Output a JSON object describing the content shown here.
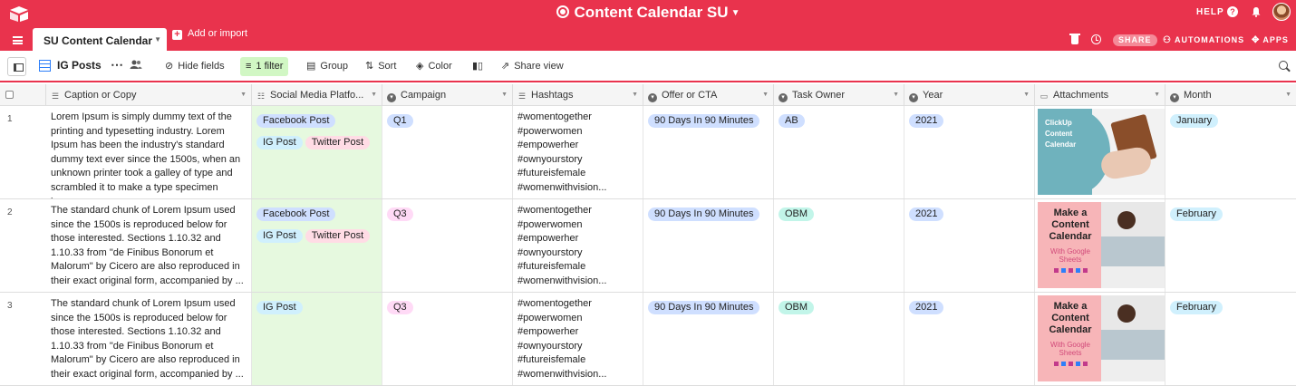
{
  "topbar": {
    "base_title": "Content Calendar SU",
    "help_label": "HELP",
    "tab_label": "SU Content Calendar",
    "add_import_label": "Add or import",
    "share_label": "SHARE",
    "automations_label": "AUTOMATIONS",
    "apps_label": "APPS",
    "colors": {
      "bar": "#e9334d"
    }
  },
  "toolbar": {
    "view_name": "IG Posts",
    "hide_fields": "Hide fields",
    "filter": "1 filter",
    "group": "Group",
    "sort": "Sort",
    "color": "Color",
    "share_view": "Share view"
  },
  "columns": [
    {
      "label": "Caption or Copy",
      "icon": "long-text-icon"
    },
    {
      "label": "Social Media Platfo...",
      "icon": "multi-select-icon"
    },
    {
      "label": "Campaign",
      "icon": "single-select-icon"
    },
    {
      "label": "Hashtags",
      "icon": "long-text-icon"
    },
    {
      "label": "Offer or CTA",
      "icon": "single-select-icon"
    },
    {
      "label": "Task Owner",
      "icon": "single-select-icon"
    },
    {
      "label": "Year",
      "icon": "single-select-icon"
    },
    {
      "label": "Attachments",
      "icon": "attachment-icon"
    },
    {
      "label": "Month",
      "icon": "single-select-icon"
    }
  ],
  "rows": [
    {
      "num": "1",
      "caption": "Lorem Ipsum is simply dummy text of the printing and typesetting industry. Lorem Ipsum has been the industry's standard dummy text ever since the 1500s, when an unknown printer took a galley of type and scrambled it to make a type specimen boo...",
      "platforms": [
        "Facebook Post",
        "IG Post",
        "Twitter Post"
      ],
      "campaign": "Q1",
      "hashtags": [
        "#womentogether",
        "#powerwomen",
        "#empowerher",
        "#ownyourstory",
        "#futureisfemale",
        "#womenwithvision..."
      ],
      "offer": "90 Days In 90 Minutes",
      "owner": "AB",
      "year": "2021",
      "attachment_text": "ClickUp Content Calendar",
      "month": "January"
    },
    {
      "num": "2",
      "caption": "The standard chunk of Lorem Ipsum used since the 1500s is reproduced below for those interested. Sections 1.10.32 and 1.10.33 from \"de Finibus Bonorum et Malorum\" by Cicero are also reproduced in their exact original form, accompanied by ...",
      "platforms": [
        "Facebook Post",
        "IG Post",
        "Twitter Post"
      ],
      "campaign": "Q3",
      "hashtags": [
        "#womentogether",
        "#powerwomen",
        "#empowerher",
        "#ownyourstory",
        "#futureisfemale",
        "#womenwithvision..."
      ],
      "offer": "90 Days In 90 Minutes",
      "owner": "OBM",
      "year": "2021",
      "attachment_text": "Make a Content Calendar",
      "attachment_sub": "With Google Sheets",
      "month": "February"
    },
    {
      "num": "3",
      "caption": "The standard chunk of Lorem Ipsum used since the 1500s is reproduced below for those interested. Sections 1.10.32 and 1.10.33 from \"de Finibus Bonorum et Malorum\" by Cicero are also reproduced in their exact original form, accompanied by ...",
      "platforms": [
        "IG Post"
      ],
      "campaign": "Q3",
      "hashtags": [
        "#womentogether",
        "#powerwomen",
        "#empowerher",
        "#ownyourstory",
        "#futureisfemale",
        "#womenwithvision..."
      ],
      "offer": "90 Days In 90 Minutes",
      "owner": "OBM",
      "year": "2021",
      "attachment_text": "Make a Content Calendar",
      "attachment_sub": "With Google Sheets",
      "month": "February"
    }
  ],
  "chip_colors": {
    "Facebook Post": "#cfdfff",
    "IG Post": "#d0f0fd",
    "Twitter Post": "#ffdce5",
    "Q1": "#cfdfff",
    "Q3": "#ffdaf6",
    "90 Days In 90 Minutes": "#cfdfff",
    "AB": "#cfdfff",
    "OBM": "#c2f5e9",
    "2021": "#cfdfff",
    "January": "#d0f0fd",
    "February": "#d0f0fd"
  }
}
